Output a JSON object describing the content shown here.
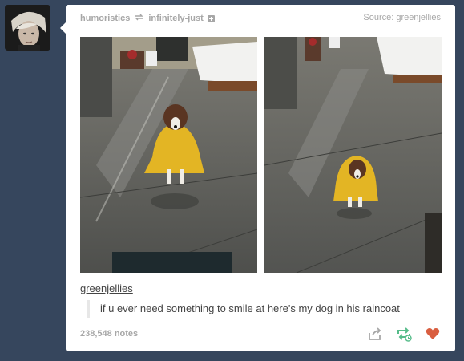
{
  "post": {
    "poster": "humoristics",
    "reblogged_from": "infinitely-just",
    "source_label": "Source: greenjellies",
    "caption": {
      "source_user": "greenjellies",
      "quote": "if u ever need something to smile at here's my dog in his raincoat"
    },
    "notes": "238,548 notes"
  },
  "icons": {
    "reblog_header": "reblog-icon",
    "follow": "follow-plus-icon",
    "share": "share-icon",
    "reblog": "reblog-icon",
    "like": "heart-icon"
  },
  "colors": {
    "background": "#36465d",
    "reblog_green": "#56bc8a",
    "like_red": "#d95e40",
    "muted": "#a7a7a7"
  }
}
